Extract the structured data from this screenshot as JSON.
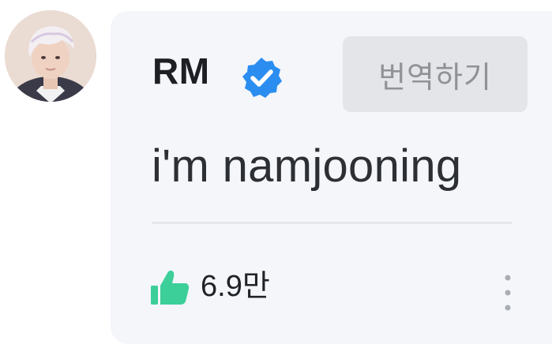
{
  "comment": {
    "author_name": "RM",
    "verified": true,
    "translate_label": "번역하기",
    "text": "i'm namjooning",
    "likes_label": "6.9만"
  },
  "icons": {
    "avatar": "profile-photo",
    "verified": "verified-badge-icon",
    "like": "thumbs-up-icon",
    "more": "more-vertical-icon"
  },
  "colors": {
    "card_background": "#f4f6fa",
    "verified_badge": "#2b8df0",
    "like_icon": "#3ccf9a",
    "translate_button_bg": "#e3e5e8",
    "translate_button_text": "#8f9297"
  }
}
